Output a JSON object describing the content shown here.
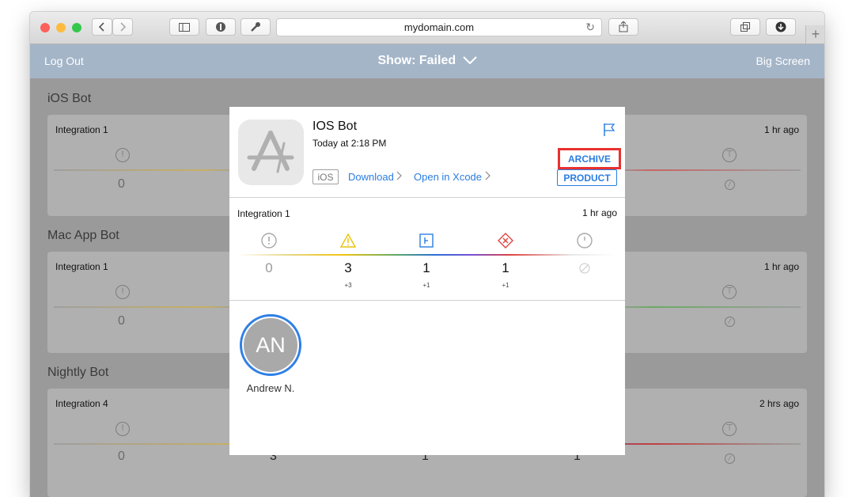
{
  "browser": {
    "url": "mydomain.com",
    "traffic_colors": [
      "#fc605b",
      "#fdbc40",
      "#34c84a"
    ],
    "icons": [
      "back-icon",
      "forward-icon",
      "sidebar-icon",
      "shield-icon",
      "wrench-icon",
      "reload-icon",
      "share-icon",
      "tabs-icon",
      "download-icon"
    ],
    "new_tab_label": "+"
  },
  "header": {
    "left": "Log Out",
    "center": "Show: Failed",
    "right": "Big Screen",
    "color": "#a4b5c8"
  },
  "bots": [
    {
      "name": "iOS Bot",
      "integration": "Integration 1",
      "ago": "1 hr ago",
      "first": "0"
    },
    {
      "name": "Mac App Bot",
      "integration": "Integration 1",
      "ago": "1 hr ago",
      "first": "0"
    },
    {
      "name": "Nightly Bot",
      "integration": "Integration 4",
      "ago": "2 hrs ago",
      "first": "0",
      "values": [
        "3",
        "1",
        "1"
      ]
    }
  ],
  "modal": {
    "title": "IOS Bot",
    "date": "Today at 2:18 PM",
    "platform": "iOS",
    "download": "Download",
    "open_xcode": "Open in Xcode",
    "archive": "ARCHIVE",
    "product": "PRODUCT",
    "integration": "Integration 1",
    "ago": "1 hr ago",
    "stats": [
      {
        "icon": "error-icon",
        "value": "0",
        "delta": ""
      },
      {
        "icon": "warning-icon",
        "value": "3",
        "delta": "+3"
      },
      {
        "icon": "analyzer-icon",
        "value": "1",
        "delta": "+1"
      },
      {
        "icon": "test-failure-icon",
        "value": "1",
        "delta": "+1"
      },
      {
        "icon": "clock-icon",
        "value": "",
        "delta": ""
      }
    ],
    "committer_initials": "AN",
    "committer_name": "Andrew N.",
    "accent": "#2a7de1",
    "highlight": "#e8312f"
  }
}
